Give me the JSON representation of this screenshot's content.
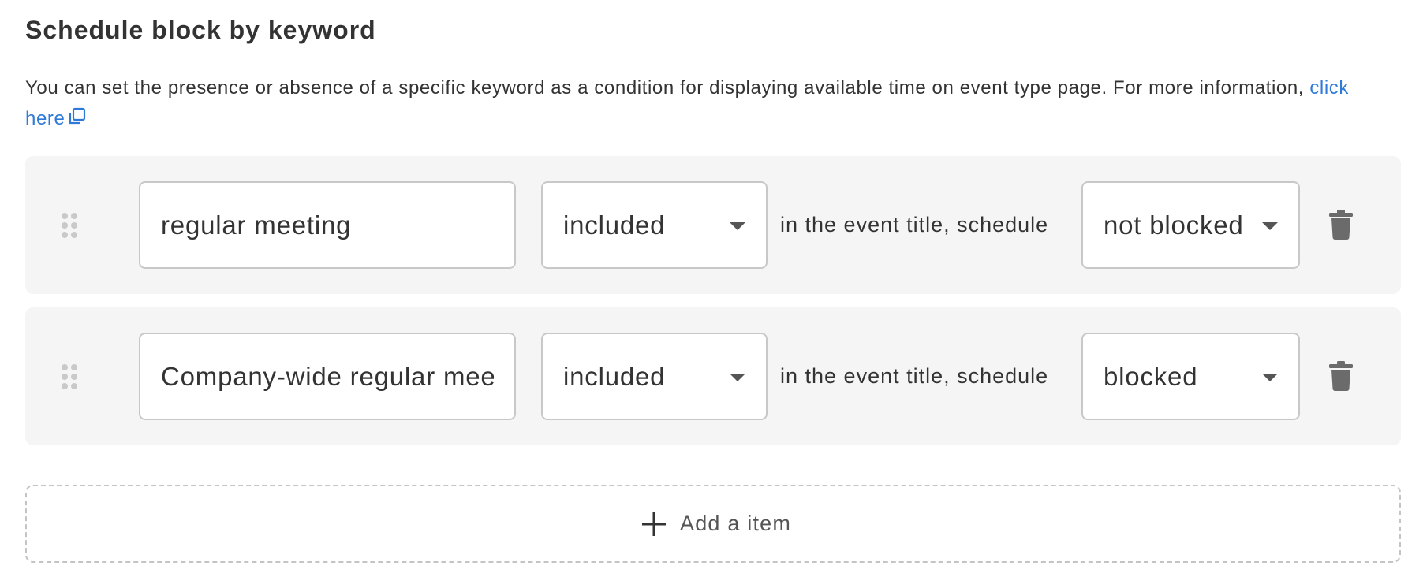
{
  "section": {
    "title": "Schedule block by keyword",
    "description": "You can set the presence or absence of a specific keyword as a condition for displaying available time on event type page. For more information, ",
    "link_label": "click here"
  },
  "rows": [
    {
      "keyword": "regular meeting",
      "condition": "included",
      "connector": "in the event title, schedule",
      "result": "not blocked"
    },
    {
      "keyword": "Company-wide regular meeting",
      "condition": "included",
      "connector": "in the event title, schedule",
      "result": "blocked"
    }
  ],
  "add_button": {
    "label": "Add a item"
  },
  "colors": {
    "link": "#2f7ad9",
    "row_background": "#f5f5f5",
    "icon_gray": "#6b6b6b"
  },
  "icons": {
    "external_link": "external-link-icon",
    "drag_handle": "drag-handle-icon",
    "delete": "trash-icon",
    "add": "plus-icon",
    "dropdown": "chevron-down-icon"
  }
}
